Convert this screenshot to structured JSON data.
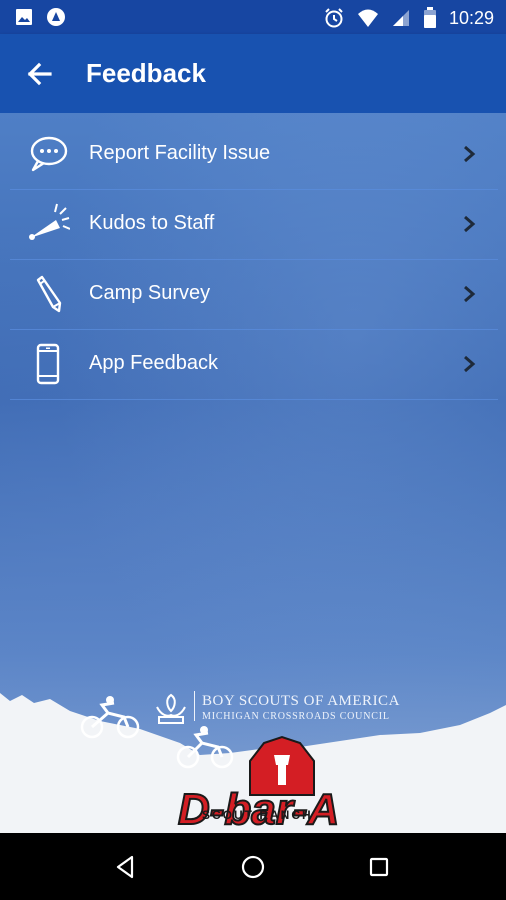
{
  "status_bar": {
    "time": "10:29",
    "left_icons": [
      "image-icon",
      "notification-icon"
    ],
    "right_icons": [
      "alarm-icon",
      "wifi-icon",
      "signal-icon",
      "battery-icon"
    ]
  },
  "app_bar": {
    "title": "Feedback",
    "back_icon": "arrow-back-icon"
  },
  "menu": [
    {
      "label": "Report Facility Issue",
      "icon": "chat-bubble-icon"
    },
    {
      "label": "Kudos to Staff",
      "icon": "megaphone-icon"
    },
    {
      "label": "Camp Survey",
      "icon": "pencil-icon"
    },
    {
      "label": "App Feedback",
      "icon": "smartphone-icon"
    }
  ],
  "branding": {
    "bsa_line1": "BOY SCOUTS OF AMERICA",
    "bsa_line2": "MICHIGAN CROSSROADS COUNCIL",
    "logo_text": "D-bar-A",
    "logo_subtitle": "SCOUT RANCH"
  },
  "colors": {
    "primary": "#1852b0",
    "status_bar": "#1746a2",
    "logo_red": "#d41e24"
  },
  "nav_bar": [
    "back-nav-icon",
    "home-nav-icon",
    "recents-nav-icon"
  ]
}
